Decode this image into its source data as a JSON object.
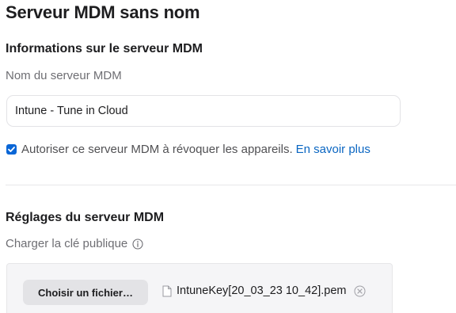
{
  "header": {
    "title": "Serveur MDM sans nom"
  },
  "server_info": {
    "heading": "Informations sur le serveur MDM",
    "name_label": "Nom du serveur MDM",
    "name_value": "Intune - Tune in Cloud",
    "revoke_checkbox": {
      "checked": true,
      "label": "Autoriser ce serveur MDM à révoquer les appareils.",
      "link_label": "En savoir plus"
    }
  },
  "server_settings": {
    "heading": "Réglages du serveur MDM",
    "public_key_label": "Charger la clé publique",
    "choose_file_label": "Choisir un fichier…",
    "file_name": "IntuneKey[20_03_23 10_42].pem"
  },
  "colors": {
    "accent": "#0a66d6",
    "link": "#0a66c2",
    "label_gray": "#6e6e73",
    "upload_bg": "#f5f5f7"
  },
  "icons": {
    "checkbox": "checkmark-icon",
    "info": "info-circle-icon",
    "file": "document-icon",
    "clear": "clear-circle-icon"
  }
}
